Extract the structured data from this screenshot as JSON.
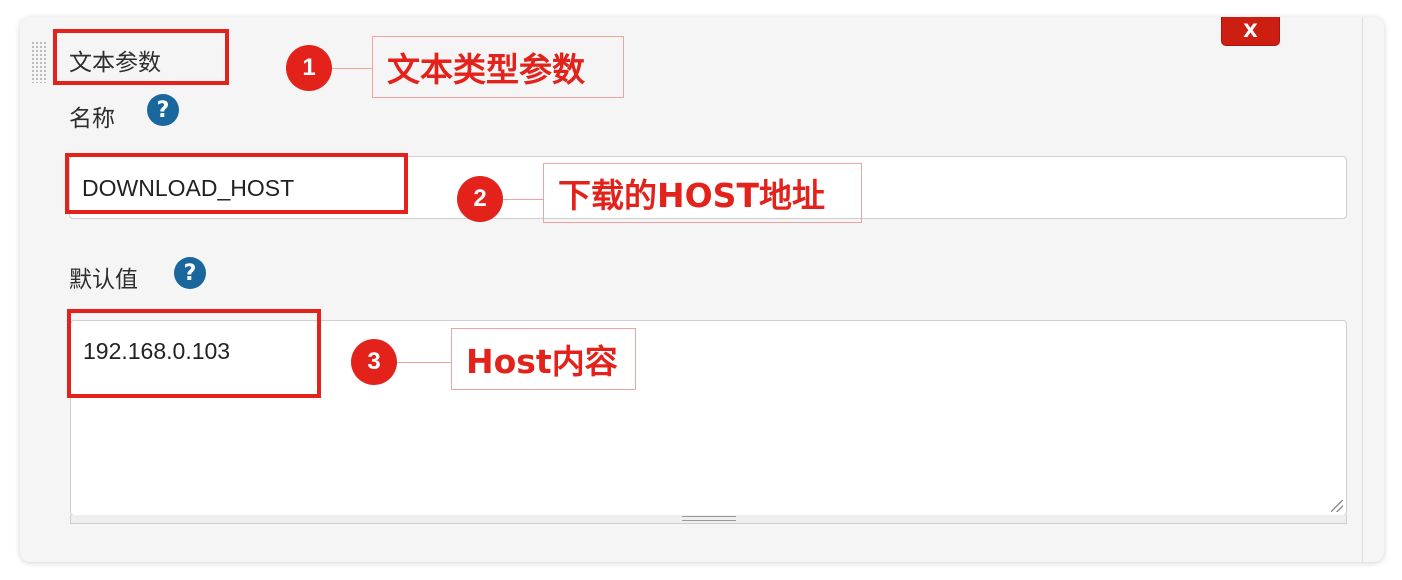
{
  "panel": {
    "title": "文本参数",
    "close_label": "X"
  },
  "fields": {
    "name_label": "名称",
    "name_value": "DOWNLOAD_HOST",
    "default_label": "默认值",
    "default_value": "192.168.0.103",
    "help_glyph": "?"
  },
  "annotations": [
    {
      "number": "1",
      "text": "文本类型参数"
    },
    {
      "number": "2",
      "text": "下载的HOST地址"
    },
    {
      "number": "3",
      "text": "Host内容"
    }
  ],
  "colors": {
    "annotation_red": "#e3221b",
    "help_blue": "#19679d",
    "close_red": "#cc1f12"
  }
}
